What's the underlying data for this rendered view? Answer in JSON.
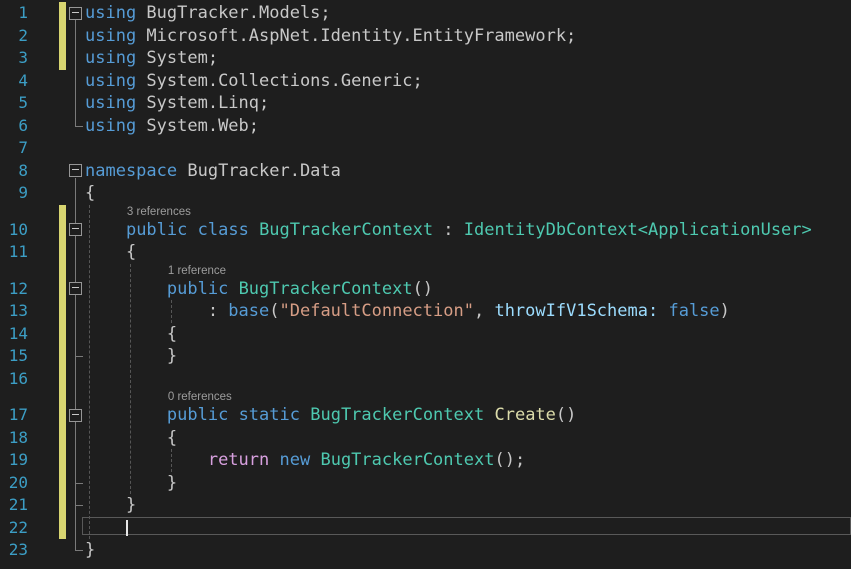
{
  "app": {
    "name": "code-editor",
    "language": "C#",
    "file_context": "BugTracker.Data / BugTrackerContext"
  },
  "colors": {
    "background": "#1e1e1e",
    "keyword": "#569CD6",
    "control": "#D8A0DF",
    "type": "#4EC9B0",
    "method": "#DCDCAA",
    "string": "#D69D85",
    "parameter": "#9CDCFE",
    "plain": "#C8C8C8",
    "line_number": "#3C9EC5",
    "codelens": "#9D9D9D",
    "change_bar": "#D8D571",
    "indent_guide": "#565656",
    "outline": "#7A7A7A",
    "fold_box_border": "#969696",
    "fold_minus": "#C8C8C8",
    "current_line_border": "#595959",
    "caret": "#E6E6E6"
  },
  "rows": [
    {
      "kind": "code",
      "num": "1",
      "fold": true,
      "tokens": [
        {
          "c": "keyword",
          "t": "using"
        },
        {
          "c": "plain",
          "t": " BugTracker.Models;"
        }
      ]
    },
    {
      "kind": "code",
      "num": "2",
      "tokens": [
        {
          "c": "keyword",
          "t": "using"
        },
        {
          "c": "plain",
          "t": " Microsoft.AspNet.Identity.EntityFramework;"
        }
      ]
    },
    {
      "kind": "code",
      "num": "3",
      "tokens": [
        {
          "c": "keyword",
          "t": "using"
        },
        {
          "c": "plain",
          "t": " System;"
        }
      ]
    },
    {
      "kind": "code",
      "num": "4",
      "tokens": [
        {
          "c": "keyword",
          "t": "using"
        },
        {
          "c": "plain",
          "t": " System.Collections.Generic;"
        }
      ]
    },
    {
      "kind": "code",
      "num": "5",
      "tokens": [
        {
          "c": "keyword",
          "t": "using"
        },
        {
          "c": "plain",
          "t": " System.Linq;"
        }
      ]
    },
    {
      "kind": "code",
      "num": "6",
      "tokens": [
        {
          "c": "keyword",
          "t": "using"
        },
        {
          "c": "plain",
          "t": " System.Web;"
        }
      ]
    },
    {
      "kind": "code",
      "num": "7",
      "tokens": []
    },
    {
      "kind": "code",
      "num": "8",
      "fold": true,
      "tokens": [
        {
          "c": "keyword",
          "t": "namespace"
        },
        {
          "c": "plain",
          "t": " BugTracker.Data"
        }
      ]
    },
    {
      "kind": "code",
      "num": "9",
      "tokens": [
        {
          "c": "plain",
          "t": "{"
        }
      ]
    },
    {
      "kind": "lens",
      "text": "3 references",
      "col": 4
    },
    {
      "kind": "code",
      "num": "10",
      "fold": true,
      "tokens": [
        {
          "c": "plain",
          "t": "    "
        },
        {
          "c": "keyword",
          "t": "public"
        },
        {
          "c": "plain",
          "t": " "
        },
        {
          "c": "keyword",
          "t": "class"
        },
        {
          "c": "plain",
          "t": " "
        },
        {
          "c": "type",
          "t": "BugTrackerContext"
        },
        {
          "c": "plain",
          "t": " : "
        },
        {
          "c": "type",
          "t": "IdentityDbContext<ApplicationUser>"
        }
      ]
    },
    {
      "kind": "code",
      "num": "11",
      "tokens": [
        {
          "c": "plain",
          "t": "    {"
        }
      ]
    },
    {
      "kind": "lens",
      "text": "1 reference",
      "col": 8
    },
    {
      "kind": "code",
      "num": "12",
      "fold": true,
      "tokens": [
        {
          "c": "plain",
          "t": "        "
        },
        {
          "c": "keyword",
          "t": "public"
        },
        {
          "c": "plain",
          "t": " "
        },
        {
          "c": "type",
          "t": "BugTrackerContext"
        },
        {
          "c": "plain",
          "t": "()"
        }
      ]
    },
    {
      "kind": "code",
      "num": "13",
      "tokens": [
        {
          "c": "plain",
          "t": "            : "
        },
        {
          "c": "keyword",
          "t": "base"
        },
        {
          "c": "plain",
          "t": "("
        },
        {
          "c": "string",
          "t": "\"DefaultConnection\""
        },
        {
          "c": "plain",
          "t": ", "
        },
        {
          "c": "parameter",
          "t": "throwIfV1Schema:"
        },
        {
          "c": "plain",
          "t": " "
        },
        {
          "c": "keyword",
          "t": "false"
        },
        {
          "c": "plain",
          "t": ")"
        }
      ]
    },
    {
      "kind": "code",
      "num": "14",
      "tokens": [
        {
          "c": "plain",
          "t": "        {"
        }
      ]
    },
    {
      "kind": "code",
      "num": "15",
      "tokens": [
        {
          "c": "plain",
          "t": "        }"
        }
      ]
    },
    {
      "kind": "code",
      "num": "16",
      "tokens": []
    },
    {
      "kind": "lens",
      "text": "0 references",
      "col": 8
    },
    {
      "kind": "code",
      "num": "17",
      "fold": true,
      "tokens": [
        {
          "c": "plain",
          "t": "        "
        },
        {
          "c": "keyword",
          "t": "public"
        },
        {
          "c": "plain",
          "t": " "
        },
        {
          "c": "keyword",
          "t": "static"
        },
        {
          "c": "plain",
          "t": " "
        },
        {
          "c": "type",
          "t": "BugTrackerContext"
        },
        {
          "c": "plain",
          "t": " "
        },
        {
          "c": "method",
          "t": "Create"
        },
        {
          "c": "plain",
          "t": "()"
        }
      ]
    },
    {
      "kind": "code",
      "num": "18",
      "tokens": [
        {
          "c": "plain",
          "t": "        {"
        }
      ]
    },
    {
      "kind": "code",
      "num": "19",
      "tokens": [
        {
          "c": "plain",
          "t": "            "
        },
        {
          "c": "control",
          "t": "return"
        },
        {
          "c": "plain",
          "t": " "
        },
        {
          "c": "keyword",
          "t": "new"
        },
        {
          "c": "plain",
          "t": " "
        },
        {
          "c": "type",
          "t": "BugTrackerContext"
        },
        {
          "c": "plain",
          "t": "();"
        }
      ]
    },
    {
      "kind": "code",
      "num": "20",
      "tokens": [
        {
          "c": "plain",
          "t": "        }"
        }
      ]
    },
    {
      "kind": "code",
      "num": "21",
      "tokens": [
        {
          "c": "plain",
          "t": "    }"
        }
      ]
    },
    {
      "kind": "code",
      "num": "22",
      "current": true,
      "caret_col": 4,
      "tokens": []
    },
    {
      "kind": "code",
      "num": "23",
      "tokens": [
        {
          "c": "plain",
          "t": "}"
        }
      ]
    }
  ],
  "structure": {
    "change_bars": [
      {
        "from_row": 0,
        "to_row": 2
      },
      {
        "from_row": 9,
        "to_row": 24
      }
    ],
    "outline_segments": [
      {
        "from_row": 0,
        "to_row": 5
      },
      {
        "from_row": 7,
        "to_row": 25
      },
      {
        "from_row": 10,
        "to_row": 23
      },
      {
        "from_row": 13,
        "to_row": 16
      },
      {
        "from_row": 19,
        "to_row": 22
      }
    ],
    "indent_guides": [
      {
        "col": 0,
        "from_row": 9,
        "to_row": 24
      },
      {
        "col": 4,
        "from_row": 12,
        "to_row": 22
      },
      {
        "col": 8,
        "from_row": 14,
        "to_row": 14
      },
      {
        "col": 8,
        "from_row": 21,
        "to_row": 21
      }
    ]
  }
}
